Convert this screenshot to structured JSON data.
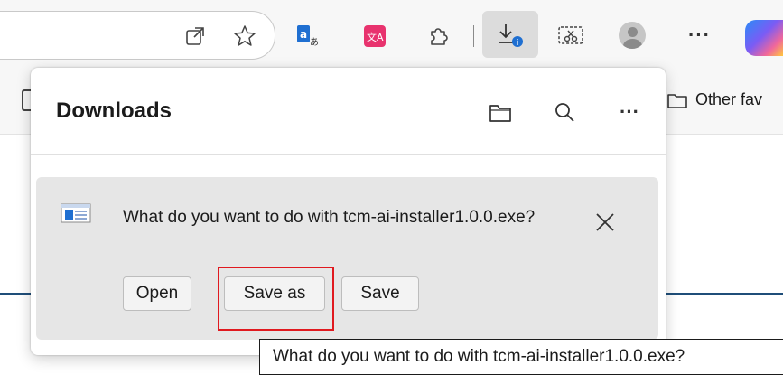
{
  "toolbar": {
    "icons": [
      "open-in-app-icon",
      "favorite-star-icon",
      "translate-icon",
      "immersive-translate-icon",
      "extensions-icon",
      "downloads-icon",
      "screenshot-icon",
      "profile-avatar",
      "more-icon",
      "copilot-icon"
    ],
    "more_label": "···"
  },
  "bookmarks": {
    "other_favorites_label": "Other fav"
  },
  "downloads": {
    "title": "Downloads",
    "header_icons": [
      "open-folder-icon",
      "search-icon",
      "more-options-icon"
    ],
    "more_label": "···",
    "item": {
      "prompt": "What do you want to do with tcm-ai-installer1.0.0.exe?",
      "buttons": {
        "open": "Open",
        "save_as": "Save as",
        "save": "Save"
      }
    }
  },
  "tooltip": {
    "text": "What do you want to do with tcm-ai-installer1.0.0.exe?"
  },
  "colors": {
    "highlight": "#e0191f",
    "accent_blue": "#1f6fd1",
    "page_line": "#1f4e79"
  }
}
